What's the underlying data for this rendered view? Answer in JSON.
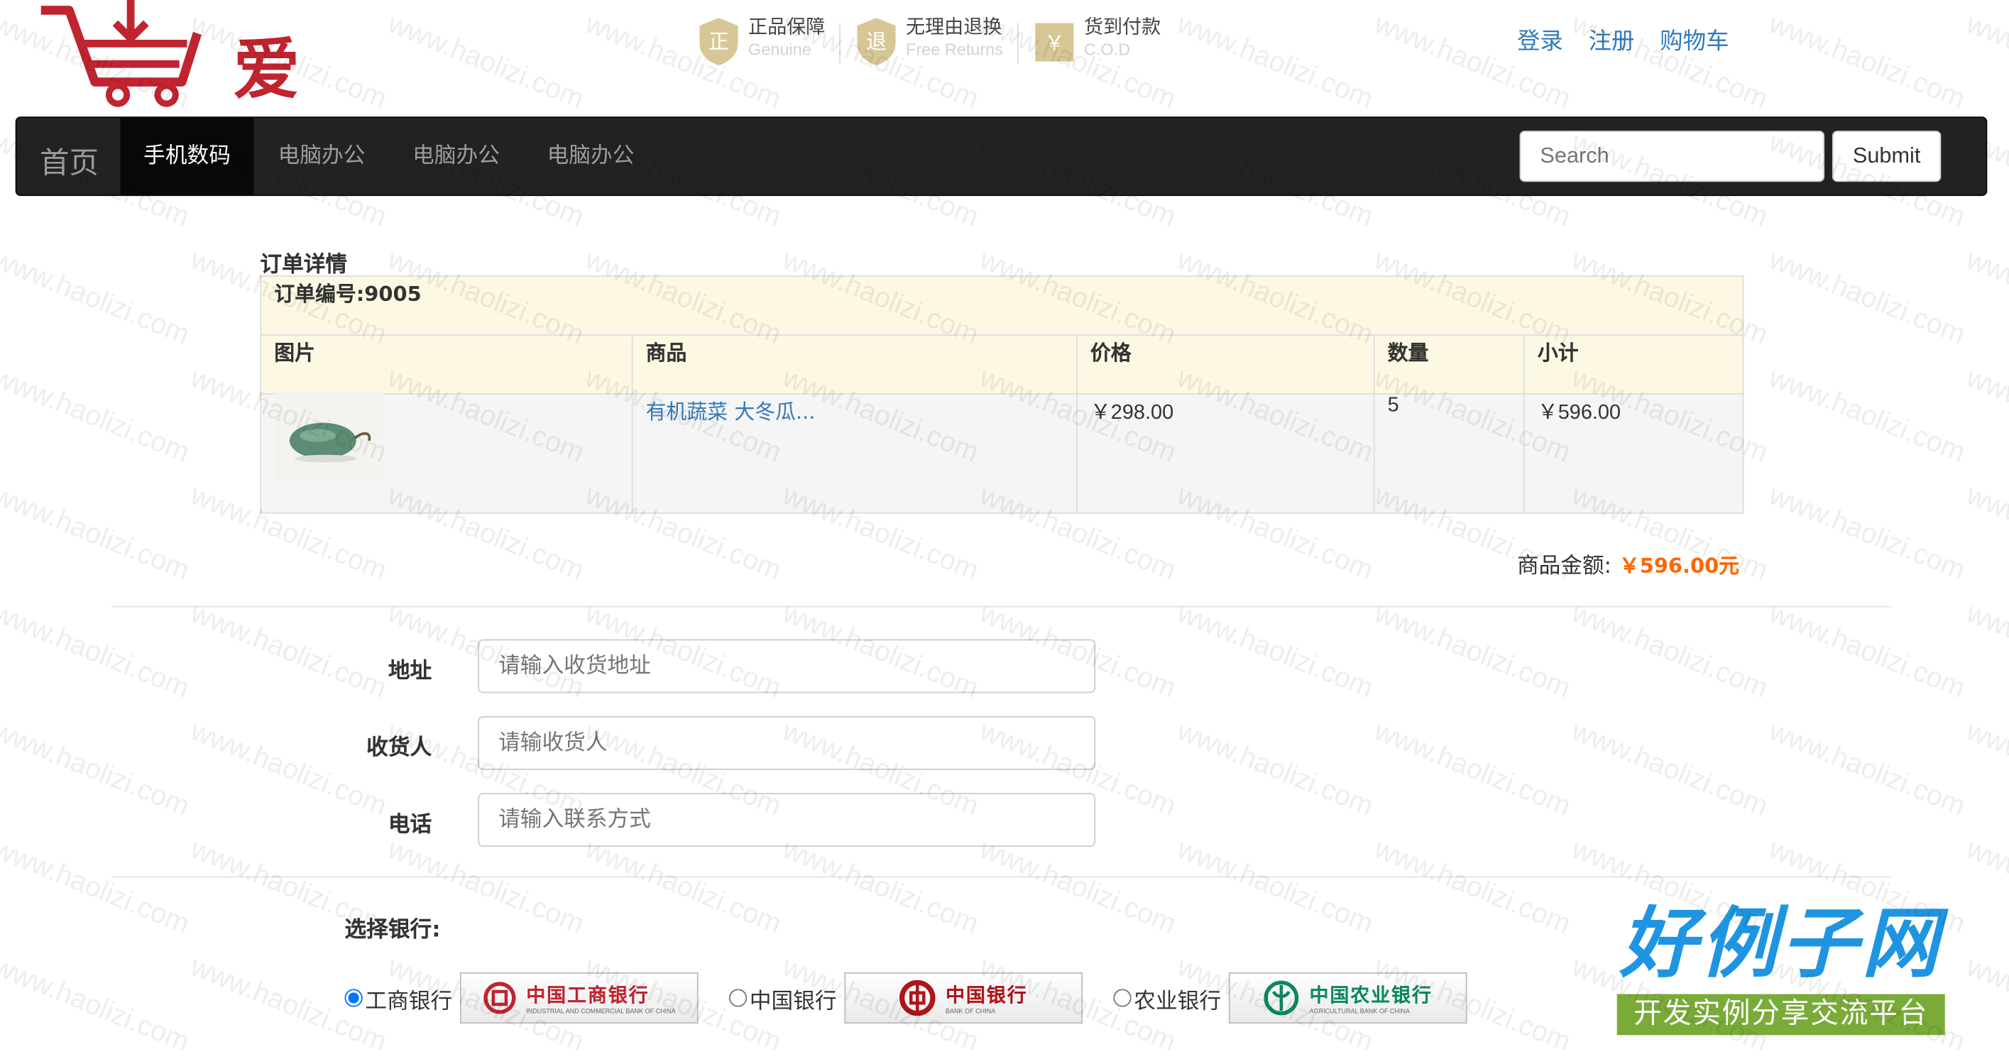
{
  "header": {
    "logo_text": "爱购",
    "promos": [
      {
        "title": "正品保障",
        "subtitle": "Genuine",
        "icon": "shield-icon"
      },
      {
        "title": "无理由退换",
        "subtitle": "Free Returns",
        "icon": "return-icon"
      },
      {
        "title": "货到付款",
        "subtitle": "C.O.D",
        "icon": "cash-icon"
      }
    ],
    "links": {
      "login": "登录",
      "register": "注册",
      "cart": "购物车"
    }
  },
  "navbar": {
    "brand": "首页",
    "items": [
      {
        "label": "手机数码",
        "active": true
      },
      {
        "label": "电脑办公",
        "active": false
      },
      {
        "label": "电脑办公",
        "active": false
      },
      {
        "label": "电脑办公",
        "active": false
      }
    ],
    "search_placeholder": "Search",
    "submit_label": "Submit"
  },
  "order": {
    "section_title": "订单详情",
    "order_number": "订单编号:9005",
    "columns": [
      "图片",
      "商品",
      "价格",
      "数量",
      "小计"
    ],
    "items": [
      {
        "product": "有机蔬菜 大冬瓜...",
        "price": "￥298.00",
        "quantity": "5",
        "subtotal": "￥596.00"
      }
    ],
    "amount_label": "商品金额:",
    "amount_value": "￥596.00元"
  },
  "form": {
    "address_label": "地址",
    "address_placeholder": "请输入收货地址",
    "receiver_label": "收货人",
    "receiver_placeholder": "请输收货人",
    "phone_label": "电话",
    "phone_placeholder": "请输入联系方式"
  },
  "bank": {
    "title": "选择银行:",
    "options": [
      {
        "label": "工商银行",
        "logo_text": "中国工商银行",
        "logo_sub": "INDUSTRIAL AND COMMERCIAL BANK OF CHINA",
        "checked": true,
        "color": "#c0242f"
      },
      {
        "label": "中国银行",
        "logo_text": "中国银行",
        "logo_sub": "BANK OF CHINA",
        "checked": false,
        "color": "#b0141b"
      },
      {
        "label": "农业银行",
        "logo_text": "中国农业银行",
        "logo_sub": "AGRICULTURAL BANK OF CHINA",
        "checked": false,
        "color": "#0a8a5a"
      }
    ]
  },
  "site_brand": {
    "title": "好例子网",
    "slogan": "开发实例分享交流平台"
  },
  "watermark": "www.haolizi.com",
  "colors": {
    "accent_link": "#337ab7",
    "price": "#ff6600",
    "navbar": "#222222",
    "logo": "#c0242f"
  }
}
